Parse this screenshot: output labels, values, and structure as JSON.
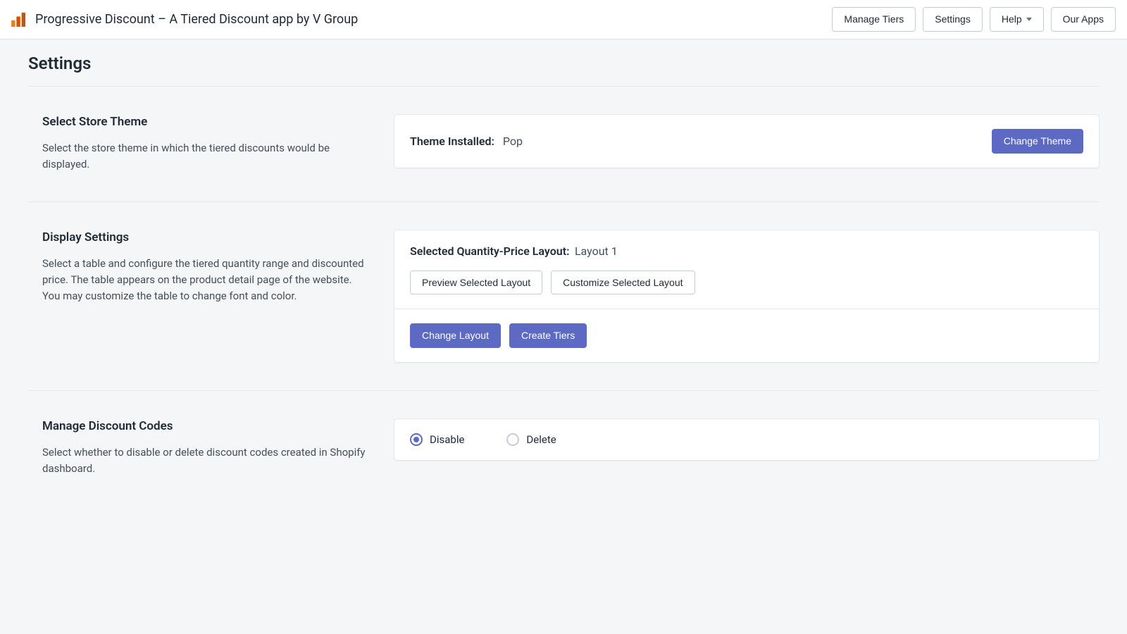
{
  "header": {
    "app_title": "Progressive Discount – A Tiered Discount app by V Group",
    "nav": {
      "manage_tiers": "Manage Tiers",
      "settings": "Settings",
      "help": "Help",
      "our_apps": "Our Apps"
    }
  },
  "page": {
    "title": "Settings"
  },
  "sections": {
    "theme": {
      "heading": "Select Store Theme",
      "desc": "Select the store theme in which the tiered discounts would be displayed.",
      "installed_label": "Theme Installed:",
      "installed_value": "Pop",
      "change_btn": "Change Theme"
    },
    "display": {
      "heading": "Display Settings",
      "desc": "Select a table and configure the tiered quantity range and discounted price. The table appears on the product detail page of the website. You may customize the table to change font and color.",
      "selected_label": "Selected Quantity-Price Layout:",
      "selected_value": "Layout 1",
      "preview_btn": "Preview Selected Layout",
      "customize_btn": "Customize Selected Layout",
      "change_layout_btn": "Change Layout",
      "create_tiers_btn": "Create Tiers"
    },
    "codes": {
      "heading": "Manage Discount Codes",
      "desc": "Select whether to disable or delete discount codes created in Shopify dashboard.",
      "options": {
        "disable": "Disable",
        "delete": "Delete"
      },
      "selected": "disable"
    }
  }
}
